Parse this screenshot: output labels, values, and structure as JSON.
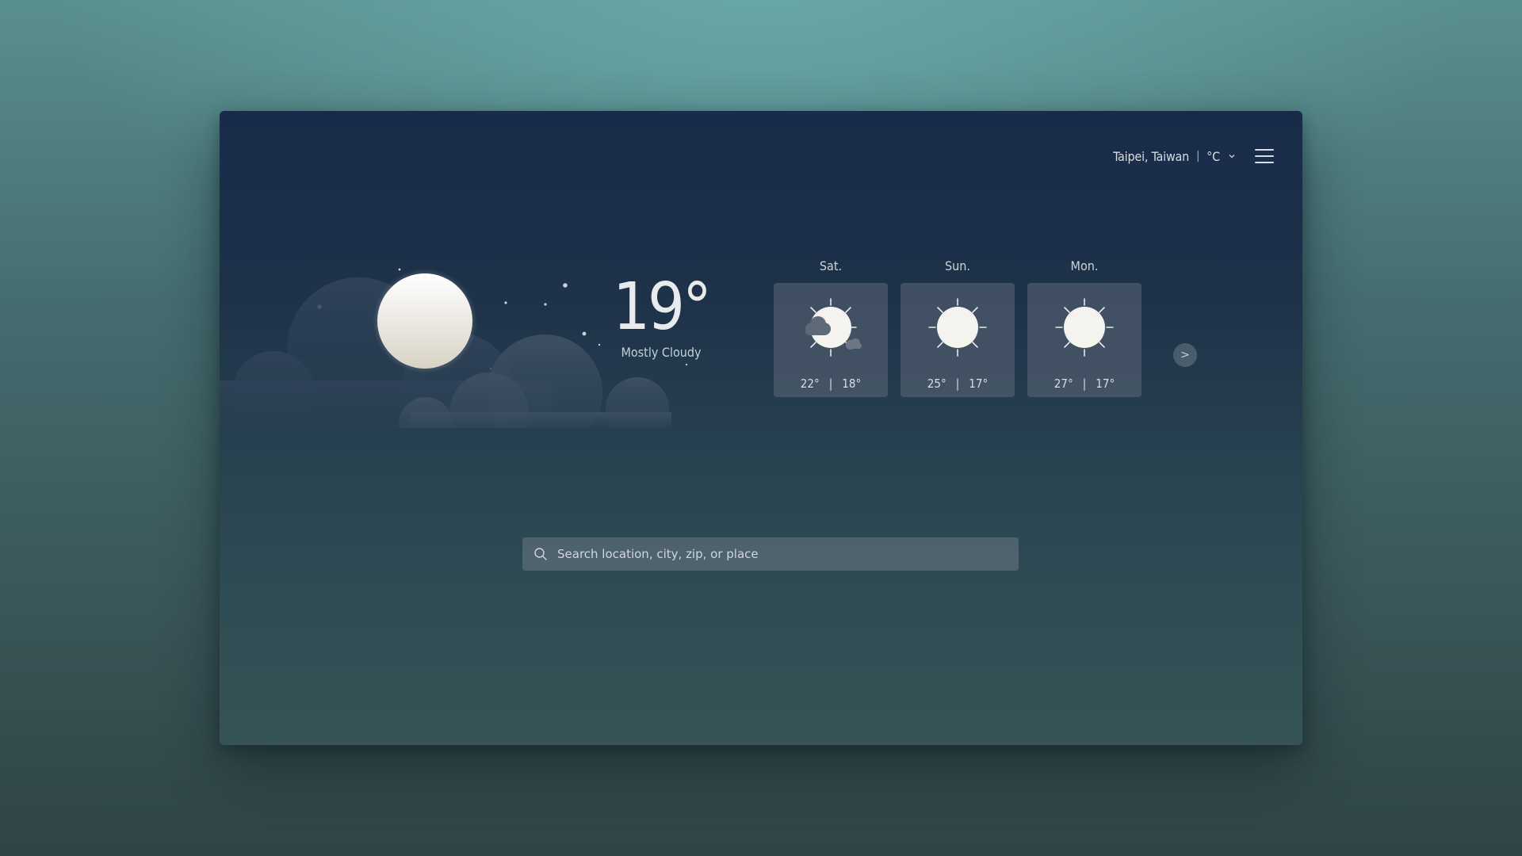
{
  "header": {
    "location": "Taipei, Taiwan",
    "separator": "|",
    "unit": "°C",
    "chevron_icon": "chevron-down-icon",
    "menu_icon": "hamburger-menu-icon"
  },
  "current": {
    "temperature": "19°",
    "condition": "Mostly Cloudy",
    "icon": "moon-clouds-night-icon"
  },
  "forecast": [
    {
      "day": "Sat.",
      "high": "22°",
      "low": "18°",
      "icon": "partly-cloudy-icon"
    },
    {
      "day": "Sun.",
      "high": "25°",
      "low": "17°",
      "icon": "sunny-icon"
    },
    {
      "day": "Mon.",
      "high": "27°",
      "low": "17°",
      "icon": "sunny-icon"
    }
  ],
  "forecast_separator": "|",
  "next_button": {
    "label": ">",
    "icon": "chevron-right-icon"
  },
  "search": {
    "placeholder": "Search location, city, zip, or place",
    "icon": "search-icon"
  },
  "colors": {
    "window_top": "#182b4a",
    "window_bottom": "#365456",
    "card": "#5c6878",
    "text": "#e6e9ec"
  }
}
